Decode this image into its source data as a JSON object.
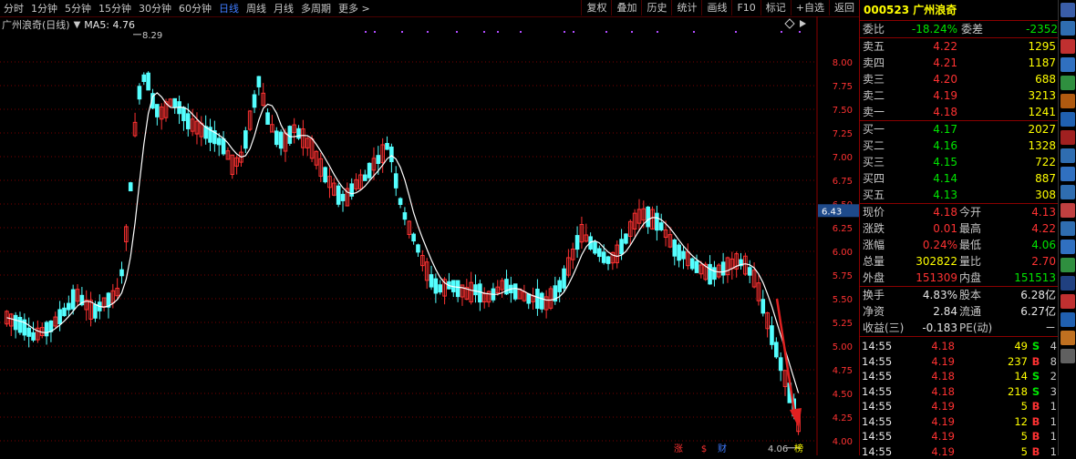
{
  "toolbar": {
    "periods": [
      "分时",
      "1分钟",
      "5分钟",
      "15分钟",
      "30分钟",
      "60分钟",
      "日线",
      "周线",
      "月线",
      "多周期",
      "更多"
    ],
    "active_index": 6,
    "buttons": [
      "复权",
      "叠加",
      "历史",
      "统计",
      "画线",
      "F10",
      "标记",
      "+自选",
      "返回"
    ]
  },
  "chart_info": {
    "title": "广州浪奇(日线)",
    "ma_label": "MA5: 4.76"
  },
  "chart_data": {
    "type": "candlestick",
    "ylim": [
      4.0,
      8.3
    ],
    "yticks": [
      "8.00",
      "7.75",
      "7.50",
      "7.25",
      "7.00",
      "6.75",
      "6.50",
      "6.25",
      "6.00",
      "5.75",
      "5.50",
      "5.25",
      "5.00",
      "4.75",
      "4.50",
      "4.25",
      "4.00"
    ],
    "high_label": "8.29",
    "low_label": "4.06",
    "price_marker": "6.43",
    "bottom_markers": [
      "涨",
      "$",
      "财",
      "榜"
    ],
    "close_path": [
      5.3,
      5.25,
      5.2,
      5.1,
      5.15,
      5.2,
      5.3,
      5.4,
      5.55,
      5.45,
      5.35,
      5.45,
      5.5,
      5.6,
      6.4,
      7.6,
      7.9,
      7.5,
      7.45,
      7.6,
      7.5,
      7.35,
      7.3,
      7.25,
      7.2,
      7.1,
      6.9,
      7.0,
      7.4,
      7.8,
      7.4,
      7.2,
      7.15,
      7.3,
      7.2,
      7.1,
      6.9,
      6.75,
      6.6,
      6.55,
      6.7,
      6.75,
      6.9,
      7.0,
      7.15,
      6.6,
      6.3,
      6.1,
      5.85,
      5.65,
      5.6,
      5.65,
      5.6,
      5.55,
      5.6,
      5.5,
      5.55,
      5.65,
      5.6,
      5.55,
      5.5,
      5.5,
      5.45,
      5.55,
      5.7,
      5.95,
      6.2,
      6.1,
      6.0,
      5.9,
      5.95,
      6.1,
      6.3,
      6.4,
      6.35,
      6.3,
      6.15,
      6.0,
      5.95,
      5.85,
      5.8,
      5.75,
      5.8,
      5.85,
      5.9,
      5.85,
      5.7,
      5.4,
      5.1,
      4.8,
      4.5,
      4.2
    ]
  },
  "quote": {
    "code": "000523",
    "name": "广州浪奇",
    "weibi": {
      "label": "委比",
      "value": "-18.24%",
      "label2": "委差",
      "value2": "-2352"
    },
    "asks": [
      {
        "label": "卖五",
        "price": "4.22",
        "vol": "1295"
      },
      {
        "label": "卖四",
        "price": "4.21",
        "vol": "1187"
      },
      {
        "label": "卖三",
        "price": "4.20",
        "vol": "688"
      },
      {
        "label": "卖二",
        "price": "4.19",
        "vol": "3213"
      },
      {
        "label": "卖一",
        "price": "4.18",
        "vol": "1241"
      }
    ],
    "bids": [
      {
        "label": "买一",
        "price": "4.17",
        "vol": "2027"
      },
      {
        "label": "买二",
        "price": "4.16",
        "vol": "1328"
      },
      {
        "label": "买三",
        "price": "4.15",
        "vol": "722"
      },
      {
        "label": "买四",
        "price": "4.14",
        "vol": "887"
      },
      {
        "label": "买五",
        "price": "4.13",
        "vol": "308"
      }
    ],
    "stats": [
      {
        "l1": "现价",
        "v1": "4.18",
        "l2": "今开",
        "v2": "4.13"
      },
      {
        "l1": "涨跌",
        "v1": "0.01",
        "l2": "最高",
        "v2": "4.22"
      },
      {
        "l1": "涨幅",
        "v1": "0.24%",
        "l2": "最低",
        "v2": "4.06"
      },
      {
        "l1": "总量",
        "v1": "302822",
        "l2": "量比",
        "v2": "2.70"
      },
      {
        "l1": "外盘",
        "v1": "151309",
        "l2": "内盘",
        "v2": "151513"
      }
    ],
    "stats2": [
      {
        "l1": "换手",
        "v1": "4.83%",
        "l2": "股本",
        "v2": "6.28亿"
      },
      {
        "l1": "净资",
        "v1": "2.84",
        "l2": "流通",
        "v2": "6.27亿"
      },
      {
        "l1": "收益(三)",
        "v1": "-0.183",
        "l2": "PE(动)",
        "v2": "－"
      }
    ],
    "ticks": [
      {
        "t": "14:55",
        "p": "4.18",
        "v": "49",
        "s": "S",
        "n": "4"
      },
      {
        "t": "14:55",
        "p": "4.19",
        "v": "237",
        "s": "B",
        "n": "8"
      },
      {
        "t": "14:55",
        "p": "4.18",
        "v": "14",
        "s": "S",
        "n": "2"
      },
      {
        "t": "14:55",
        "p": "4.18",
        "v": "218",
        "s": "S",
        "n": "3"
      },
      {
        "t": "14:55",
        "p": "4.19",
        "v": "5",
        "s": "B",
        "n": "1"
      },
      {
        "t": "14:55",
        "p": "4.19",
        "v": "12",
        "s": "B",
        "n": "1"
      },
      {
        "t": "14:55",
        "p": "4.19",
        "v": "5",
        "s": "B",
        "n": "1"
      },
      {
        "t": "14:55",
        "p": "4.19",
        "v": "5",
        "s": "B",
        "n": "1"
      }
    ]
  },
  "sidebar_icons": [
    "arrows-up-icon",
    "grid-icon",
    "chart-icon",
    "list-icon",
    "table-icon",
    "pie-icon",
    "bars-icon",
    "candle-icon",
    "f10-icon",
    "doc-icon",
    "grid2-icon",
    "news-icon",
    "grid3-icon",
    "list2-icon",
    "bars2-icon",
    "rsi-icon",
    "people-icon",
    "move-icon",
    "pencil-icon",
    "lock-icon"
  ]
}
